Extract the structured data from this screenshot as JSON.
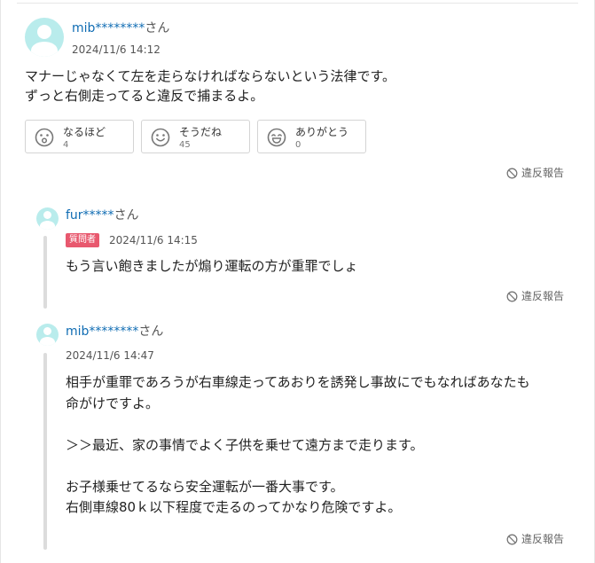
{
  "answer": {
    "username": "mib********",
    "honorific": "さん",
    "timestamp": "2024/11/6 14:12",
    "lines": [
      "マナーじゃなくて左を走らなければならないという法律です。",
      "ずっと右側走ってると違反で捕まるよ。"
    ],
    "reactions": [
      {
        "label": "なるほど",
        "count": "4",
        "icon": "surprised-face-icon"
      },
      {
        "label": "そうだね",
        "count": "45",
        "icon": "smile-face-icon"
      },
      {
        "label": "ありがとう",
        "count": "0",
        "icon": "grin-face-icon"
      }
    ],
    "report_label": "違反報告"
  },
  "replies": [
    {
      "username": "fur*****",
      "honorific": "さん",
      "badge": "質問者",
      "timestamp": "2024/11/6 14:15",
      "lines": [
        "もう言い飽きましたが煽り運転の方が重罪でしょ"
      ],
      "report_label": "違反報告"
    },
    {
      "username": "mib********",
      "honorific": "さん",
      "timestamp": "2024/11/6 14:47",
      "lines": [
        "相手が重罪であろうが右車線走ってあおりを誘発し事故にでもなればあなたも",
        "命がけですよ。",
        "",
        "＞＞最近、家の事情でよく子供を乗せて遠方まで走ります。",
        "",
        "お子様乗せてるなら安全運転が一番大事です。",
        "右側車線80ｋ以下程度で走るのってかなり危険ですよ。"
      ],
      "report_label": "違反報告"
    }
  ],
  "colors": {
    "username": "#0f6cb3",
    "avatar": "#b9ecec",
    "badge": "#e8586e",
    "thread_line": "#dcdcdc",
    "border": "#d4d4d4"
  }
}
